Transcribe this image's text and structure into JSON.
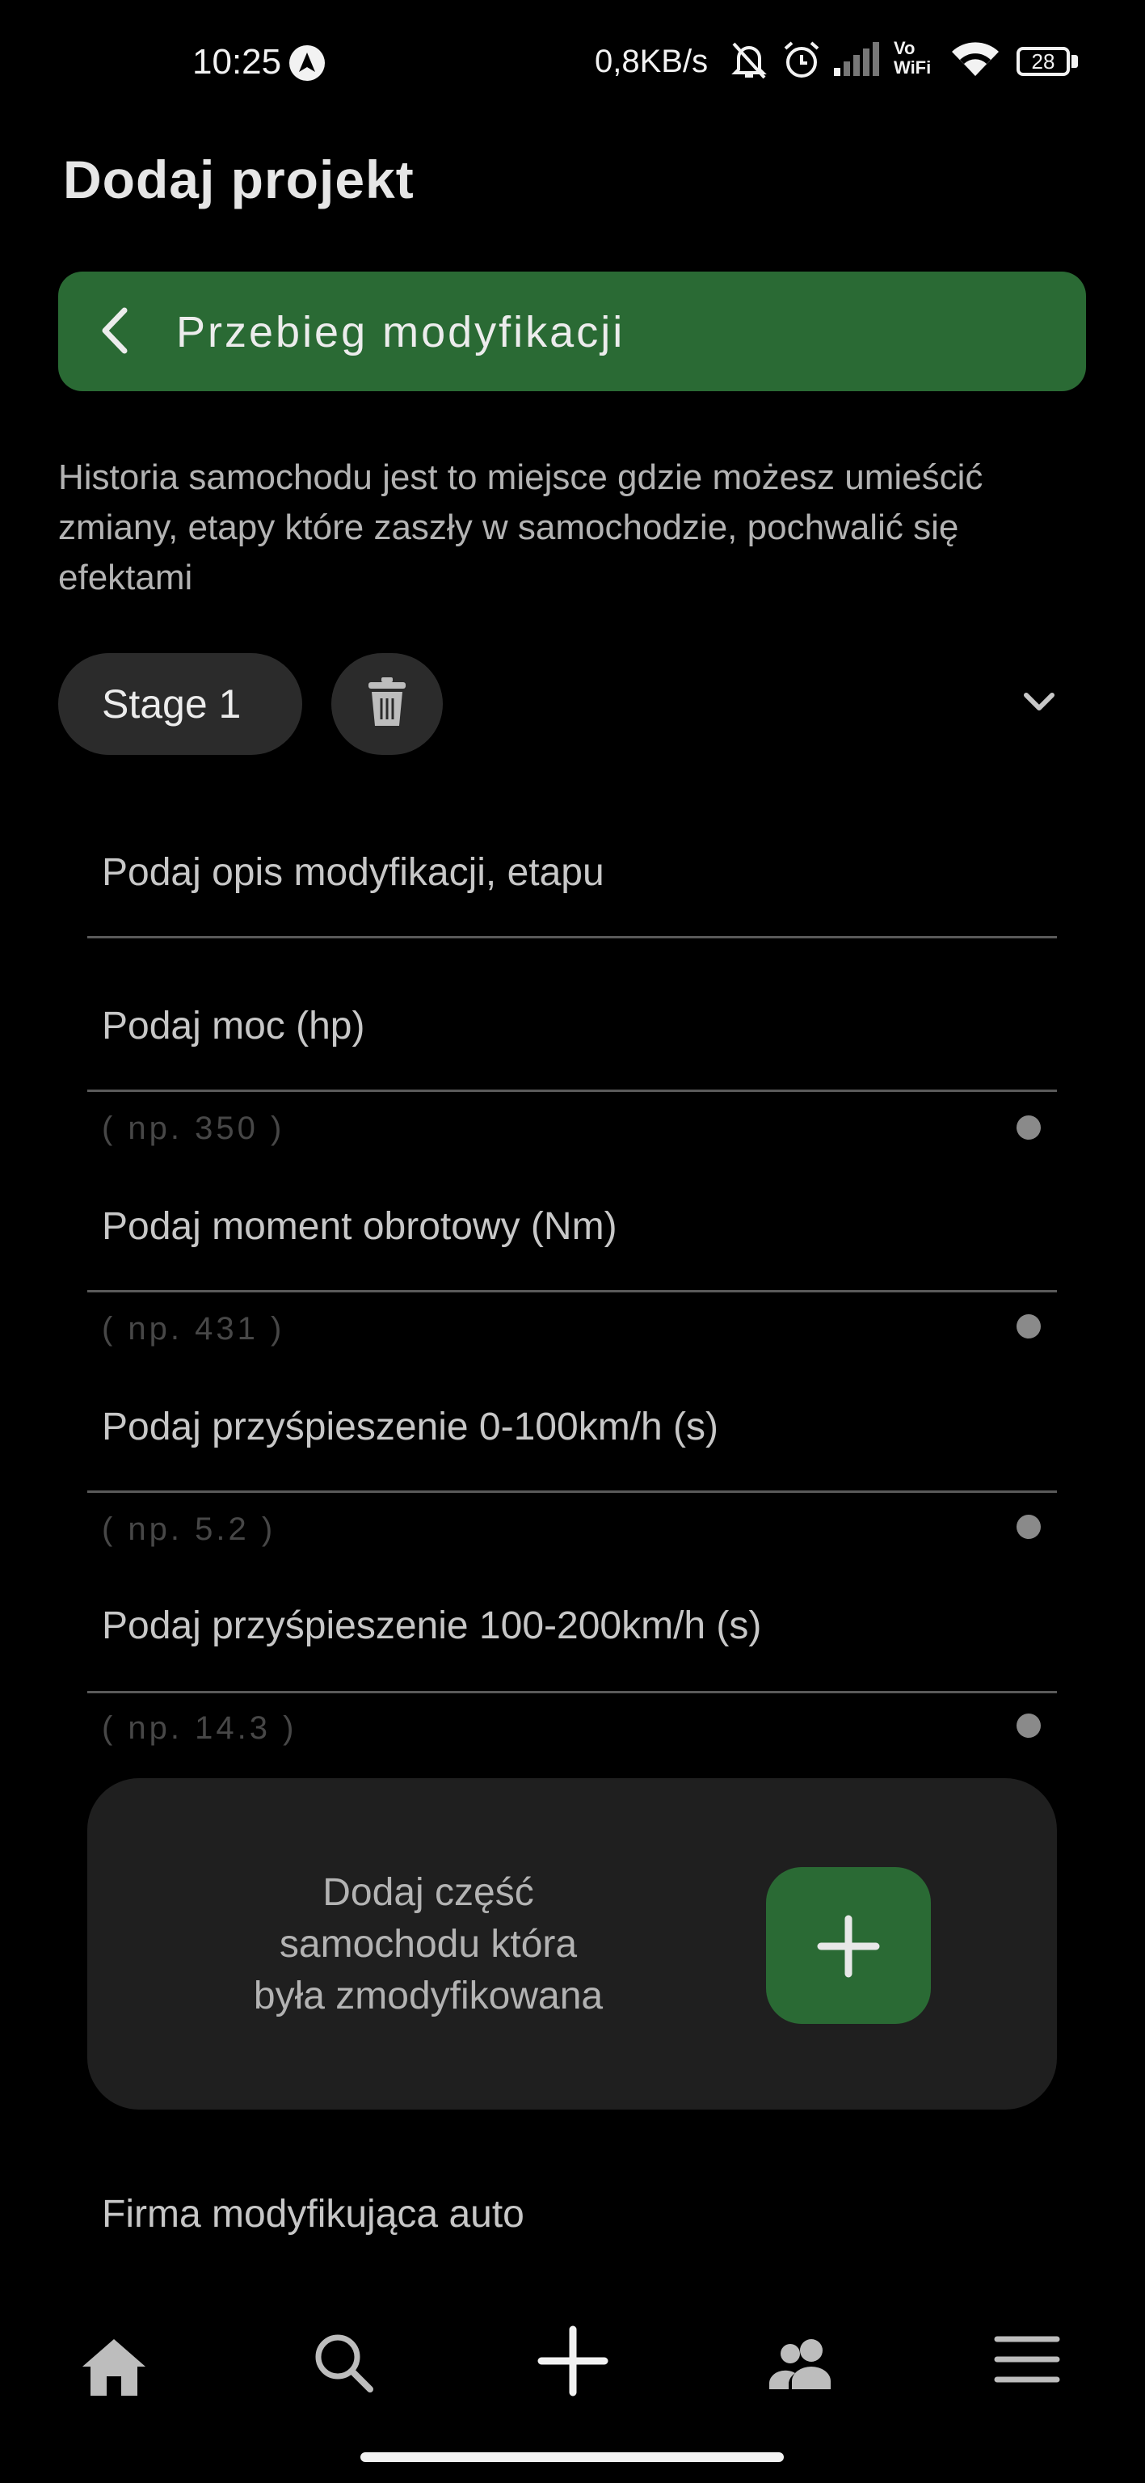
{
  "status_bar": {
    "time": "10:25",
    "time_badge_icon": "navigation-icon",
    "network_speed": "0,8KB/s",
    "icons": [
      "mute-bell-icon",
      "alarm-icon",
      "signal-icon",
      "vowifi-icon",
      "wifi-icon",
      "battery-icon"
    ],
    "vowifi_top": "Vo",
    "vowifi_bottom": "WiFi",
    "battery": "28"
  },
  "page": {
    "title": "Dodaj projekt"
  },
  "section": {
    "back_icon": "chevron-left-icon",
    "label": "Przebieg modyfikacji"
  },
  "description": "Historia samochodu jest to miejsce gdzie możesz umieścić zmiany, etapy które zaszły w samochodzie, pochwalić się efektami",
  "stage": {
    "label": "Stage 1",
    "delete_icon": "trash-icon",
    "expand_icon": "chevron-down-icon"
  },
  "fields": {
    "description_placeholder": "Podaj opis modyfikacji, etapu",
    "power": {
      "placeholder": "Podaj moc (hp)",
      "hint": "( np. 350 )"
    },
    "torque": {
      "placeholder": "Podaj moment obrotowy (Nm)",
      "hint": "( np. 431 )"
    },
    "accel_0_100": {
      "placeholder": "Podaj przyśpieszenie 0-100km/h (s)",
      "hint": "( np. 5.2 )"
    },
    "accel_100_200": {
      "placeholder": "Podaj przyśpieszenie 100-200km/h (s)",
      "hint": "( np. 14.3 )"
    }
  },
  "add_part": {
    "line1": "Dodaj część",
    "line2": "samochodu która",
    "line3": "była zmodyfikowana",
    "icon": "plus-icon"
  },
  "firm_placeholder": "Firma modyfikująca auto",
  "bottom_nav": {
    "items": [
      "home-icon",
      "search-icon",
      "add-icon",
      "people-icon",
      "menu-icon"
    ]
  },
  "colors": {
    "accent_green": "#2a6a34",
    "background": "#000000",
    "card": "#1f1f1f",
    "pill": "#2b2b2b"
  }
}
